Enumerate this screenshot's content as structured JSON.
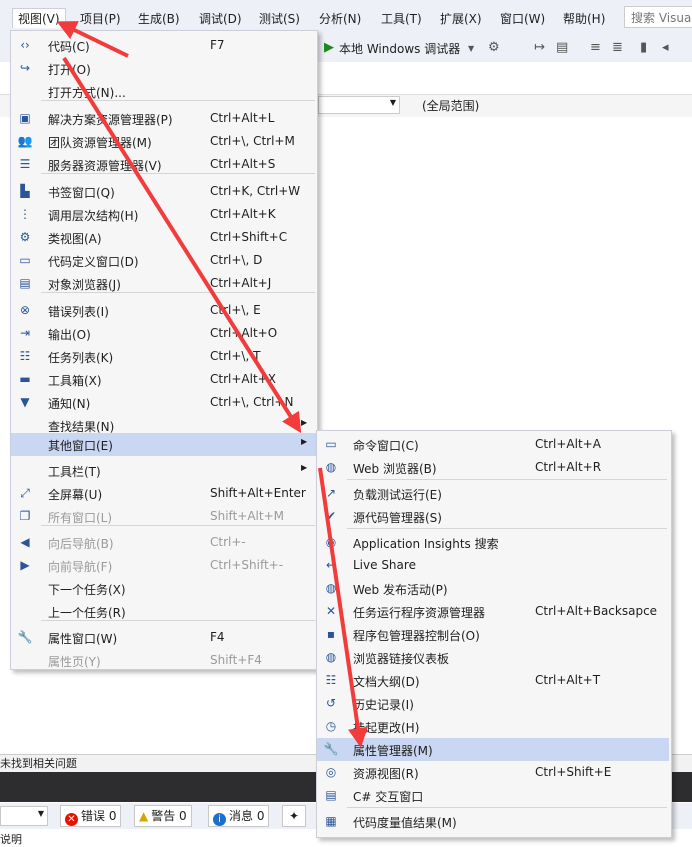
{
  "menubar": {
    "items": [
      "视图(V)",
      "项目(P)",
      "生成(B)",
      "调试(D)",
      "测试(S)",
      "分析(N)",
      "工具(T)",
      "扩展(X)",
      "窗口(W)",
      "帮助(H)"
    ],
    "search_placeholder": "搜索 Visual"
  },
  "toolbar": {
    "run_label": "本地 Windows 调试器"
  },
  "navbar": {
    "scope": "(全局范围)"
  },
  "view_menu": {
    "items": [
      {
        "label": "代码(C)",
        "shortcut": "F7",
        "icon": "code-icon"
      },
      {
        "label": "打开(O)",
        "shortcut": "",
        "icon": "open-icon"
      },
      {
        "label": "打开方式(N)...",
        "shortcut": "",
        "icon": ""
      },
      {
        "label": "解决方案资源管理器(P)",
        "shortcut": "Ctrl+Alt+L",
        "icon": "solution-explorer-icon"
      },
      {
        "label": "团队资源管理器(M)",
        "shortcut": "Ctrl+\\, Ctrl+M",
        "icon": "team-explorer-icon"
      },
      {
        "label": "服务器资源管理器(V)",
        "shortcut": "Ctrl+Alt+S",
        "icon": "server-explorer-icon"
      },
      {
        "label": "书签窗口(Q)",
        "shortcut": "Ctrl+K, Ctrl+W",
        "icon": "bookmark-icon"
      },
      {
        "label": "调用层次结构(H)",
        "shortcut": "Ctrl+Alt+K",
        "icon": "call-hierarchy-icon"
      },
      {
        "label": "类视图(A)",
        "shortcut": "Ctrl+Shift+C",
        "icon": "class-view-icon"
      },
      {
        "label": "代码定义窗口(D)",
        "shortcut": "Ctrl+\\, D",
        "icon": "code-definition-icon"
      },
      {
        "label": "对象浏览器(J)",
        "shortcut": "Ctrl+Alt+J",
        "icon": "object-browser-icon"
      },
      {
        "label": "错误列表(I)",
        "shortcut": "Ctrl+\\, E",
        "icon": "error-list-icon"
      },
      {
        "label": "输出(O)",
        "shortcut": "Ctrl+Alt+O",
        "icon": "output-icon"
      },
      {
        "label": "任务列表(K)",
        "shortcut": "Ctrl+\\, T",
        "icon": "task-list-icon"
      },
      {
        "label": "工具箱(X)",
        "shortcut": "Ctrl+Alt+X",
        "icon": "toolbox-icon"
      },
      {
        "label": "通知(N)",
        "shortcut": "Ctrl+\\, Ctrl+N",
        "icon": "notification-icon"
      },
      {
        "label": "查找结果(N)",
        "shortcut": "",
        "icon": ""
      },
      {
        "label": "其他窗口(E)",
        "shortcut": "",
        "icon": ""
      },
      {
        "label": "工具栏(T)",
        "shortcut": "",
        "icon": ""
      },
      {
        "label": "全屏幕(U)",
        "shortcut": "Shift+Alt+Enter",
        "icon": "fullscreen-icon"
      },
      {
        "label": "所有窗口(L)",
        "shortcut": "Shift+Alt+M",
        "icon": "all-windows-icon"
      },
      {
        "label": "向后导航(B)",
        "shortcut": "Ctrl+-",
        "icon": "navigate-back-icon"
      },
      {
        "label": "向前导航(F)",
        "shortcut": "Ctrl+Shift+-",
        "icon": "navigate-forward-icon"
      },
      {
        "label": "下一个任务(X)",
        "shortcut": "",
        "icon": ""
      },
      {
        "label": "上一个任务(R)",
        "shortcut": "",
        "icon": ""
      },
      {
        "label": "属性窗口(W)",
        "shortcut": "F4",
        "icon": "wrench-icon"
      },
      {
        "label": "属性页(Y)",
        "shortcut": "Shift+F4",
        "icon": ""
      }
    ]
  },
  "other_menu": {
    "items": [
      {
        "label": "命令窗口(C)",
        "shortcut": "Ctrl+Alt+A",
        "icon": "command-window-icon"
      },
      {
        "label": "Web 浏览器(B)",
        "shortcut": "Ctrl+Alt+R",
        "icon": "web-browser-icon"
      },
      {
        "label": "负载测试运行(E)",
        "shortcut": "",
        "icon": "load-test-icon"
      },
      {
        "label": "源代码管理器(S)",
        "shortcut": "",
        "icon": "source-control-icon"
      },
      {
        "label": "Application Insights 搜索",
        "shortcut": "",
        "icon": "app-insights-icon"
      },
      {
        "label": "Live Share",
        "shortcut": "",
        "icon": "live-share-icon"
      },
      {
        "label": "Web 发布活动(P)",
        "shortcut": "",
        "icon": "web-publish-icon"
      },
      {
        "label": "任务运行程序资源管理器",
        "shortcut": "Ctrl+Alt+Backsapce",
        "icon": "task-runner-icon"
      },
      {
        "label": "程序包管理器控制台(O)",
        "shortcut": "",
        "icon": "package-console-icon"
      },
      {
        "label": "浏览器链接仪表板",
        "shortcut": "",
        "icon": "browser-link-icon"
      },
      {
        "label": "文档大纲(D)",
        "shortcut": "Ctrl+Alt+T",
        "icon": "document-outline-icon"
      },
      {
        "label": "历史记录(I)",
        "shortcut": "",
        "icon": "history-icon"
      },
      {
        "label": "挂起更改(H)",
        "shortcut": "",
        "icon": "pending-changes-icon"
      },
      {
        "label": "属性管理器(M)",
        "shortcut": "",
        "icon": "wrench-icon"
      },
      {
        "label": "资源视图(R)",
        "shortcut": "Ctrl+Shift+E",
        "icon": "resource-view-icon"
      },
      {
        "label": "C# 交互窗口",
        "shortcut": "",
        "icon": "csharp-interactive-icon"
      },
      {
        "label": "代码度量值结果(M)",
        "shortcut": "",
        "icon": "code-metrics-icon"
      }
    ]
  },
  "bottom": {
    "panel_text": "未找到相关问题",
    "errors_label": "错误 0",
    "warnings_label": "警告 0",
    "messages_label": "消息 0",
    "description_label": "说明"
  },
  "colors": {
    "highlight": "#c9d7f2",
    "annotation_arrow": "#f23b3b"
  }
}
